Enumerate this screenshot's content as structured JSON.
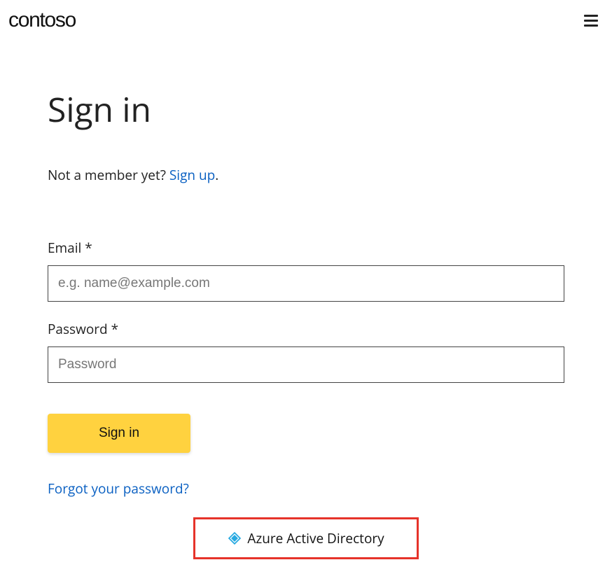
{
  "header": {
    "logo_text": "contoso"
  },
  "signin": {
    "title": "Sign in",
    "not_member_prefix": "Not a member yet? ",
    "signup_label": "Sign up",
    "not_member_suffix": ".",
    "email_label": "Email *",
    "email_placeholder": "e.g. name@example.com",
    "email_value": "",
    "password_label": "Password *",
    "password_placeholder": "Password",
    "password_value": "",
    "submit_label": "Sign in",
    "forgot_label": "Forgot your password?",
    "aad_label": "Azure Active Directory"
  },
  "colors": {
    "link": "#0a60c2",
    "accent": "#ffd23f",
    "highlight_border": "#e6332a",
    "aad_icon": "#27a9e1"
  }
}
